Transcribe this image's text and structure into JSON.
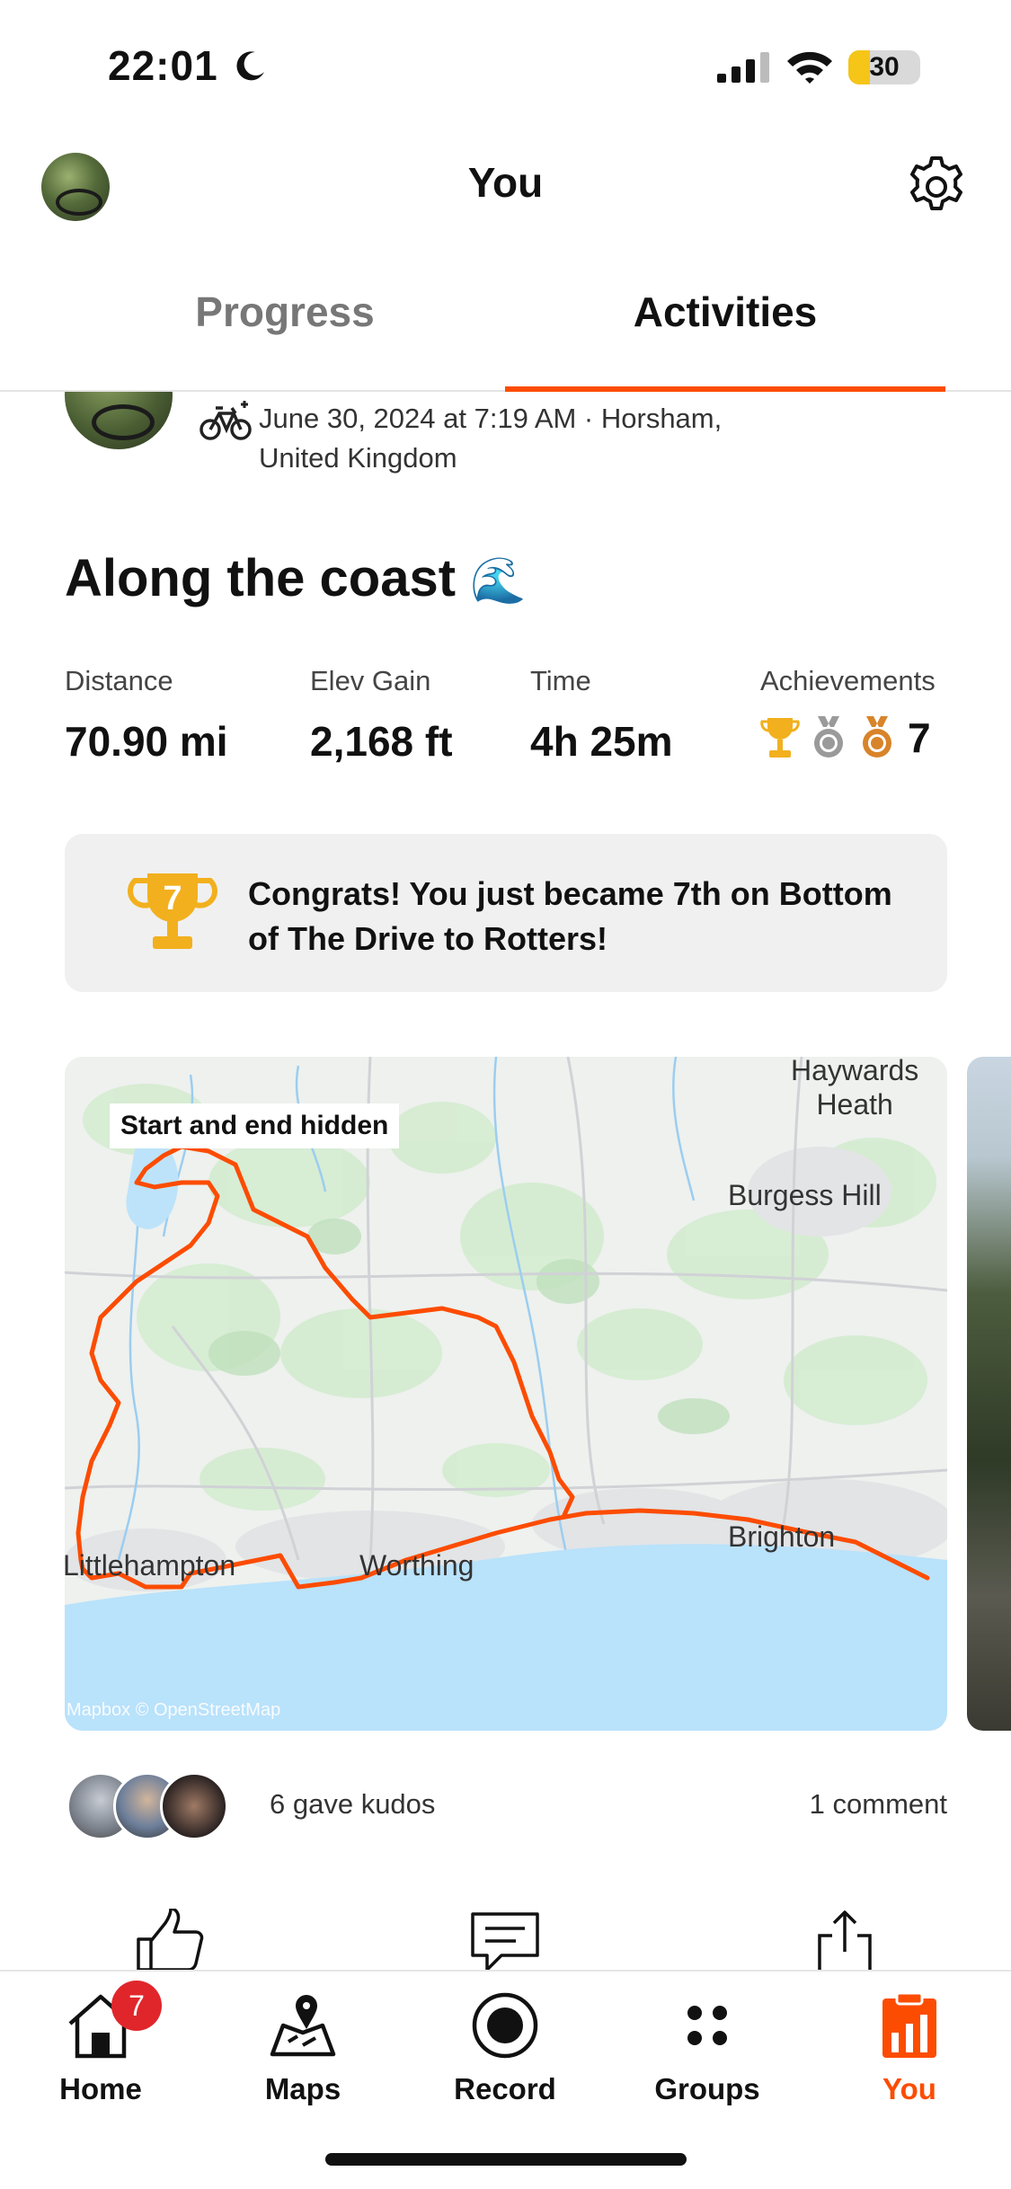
{
  "status_bar": {
    "time": "22:01",
    "battery": "30",
    "battery_level": 0.3,
    "icons": [
      "moon-icon",
      "cellular-signal-icon",
      "wifi-icon",
      "battery-icon"
    ]
  },
  "header": {
    "title": "You"
  },
  "tabs": [
    {
      "label": "Progress",
      "selected": false
    },
    {
      "label": "Activities",
      "selected": true
    }
  ],
  "activity": {
    "date_line1": "June 30, 2024 at 7:19 AM · Horsham,",
    "date_line2": "United Kingdom",
    "title": "Along the coast",
    "title_emoji": "🌊",
    "stats": {
      "distance": {
        "label": "Distance",
        "value": "70.90 mi"
      },
      "elev": {
        "label": "Elev Gain",
        "value": "2,168 ft"
      },
      "time": {
        "label": "Time",
        "value": "4h 25m"
      },
      "achievements": {
        "label": "Achievements",
        "value": "7"
      }
    },
    "congrats": {
      "trophy_number": "7",
      "text": "Congrats! You just became 7th on Bottom of The Drive to Rotters!"
    },
    "map": {
      "badge": "Start and end hidden",
      "places": [
        "Haywards Heath",
        "Burgess Hill",
        "Littlehampton",
        "Worthing",
        "Brighton"
      ],
      "place_haywards_1": "Haywards",
      "place_haywards_2": "Heath",
      "attribution": "Mapbox © OpenStreetMap",
      "route_color": "#fc4c02"
    },
    "kudos_text": "6 gave kudos",
    "comment_text": "1 comment"
  },
  "bottom_nav": {
    "items": [
      {
        "label": "Home",
        "badge": "7",
        "icon": "home-icon"
      },
      {
        "label": "Maps",
        "icon": "maps-icon"
      },
      {
        "label": "Record",
        "icon": "record-icon"
      },
      {
        "label": "Groups",
        "icon": "groups-icon"
      },
      {
        "label": "You",
        "icon": "you-icon",
        "selected": true
      }
    ],
    "accent_color": "#fc4c02"
  }
}
